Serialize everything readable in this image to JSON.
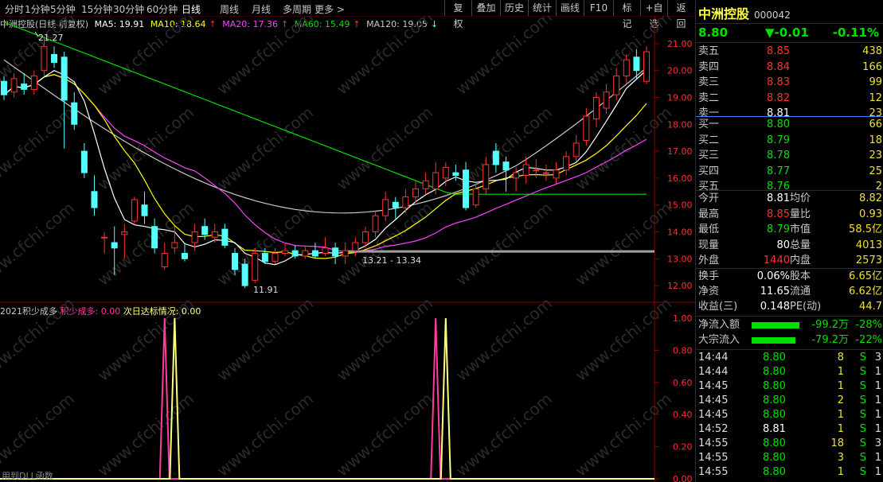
{
  "toolbar": {
    "periods": [
      "分时",
      "1分钟",
      "5分钟",
      "15分钟",
      "30分钟",
      "60分钟",
      "日线",
      "周线",
      "月线",
      "多周期",
      "更多 >"
    ],
    "active_period": "日线",
    "right_buttons": [
      "复权",
      "叠加",
      "历史",
      "统计",
      "画线",
      "F10",
      "标记",
      "+自选",
      "返回"
    ]
  },
  "ma_bar": {
    "title": "中洲控股(日线 前复权)",
    "ma5": "MA5: 19.91",
    "ma10": "MA10: 18.64",
    "ma20": "MA20: 17.36",
    "ma60": "MA60: 15.49",
    "ma120": "MA120: 19.05"
  },
  "colors": {
    "up": "#ff3232",
    "down": "#54ffff",
    "ma5": "#ffffff",
    "ma10": "#ffff00",
    "ma20": "#ff40ff",
    "ma60": "#00e000",
    "ma120": "#c8c8c8",
    "grid": "#8b0000"
  },
  "price_axis": [
    "21.00",
    "20.00",
    "19.00",
    "18.00",
    "17.00",
    "16.00",
    "15.00",
    "14.00",
    "13.00",
    "12.00"
  ],
  "annotations": {
    "high": "21.27",
    "low": "11.91",
    "range": "13.21 - 13.34"
  },
  "indicator": {
    "name": "2021积少成多",
    "series1_label": "积少成多: 0.00",
    "series2_label": "次日达标情况: 0.00",
    "axis": [
      "1.00",
      "0.80",
      "0.60",
      "0.40",
      "0.20",
      "0.00"
    ]
  },
  "footer_note": "用到DLL函数",
  "watermark": "www.cfchi.com",
  "quote": {
    "name": "中洲控股",
    "code": "000042",
    "price": "8.80",
    "change": "▼-0.01",
    "change_pct": "-0.11%",
    "asks": [
      {
        "label": "卖五",
        "price": "8.85",
        "vol": "438"
      },
      {
        "label": "卖四",
        "price": "8.84",
        "vol": "166"
      },
      {
        "label": "卖三",
        "price": "8.83",
        "vol": "99"
      },
      {
        "label": "卖二",
        "price": "8.82",
        "vol": "12"
      },
      {
        "label": "卖一",
        "price": "8.81",
        "vol": "23"
      }
    ],
    "bids": [
      {
        "label": "买一",
        "price": "8.80",
        "vol": "66"
      },
      {
        "label": "买二",
        "price": "8.79",
        "vol": "18"
      },
      {
        "label": "买三",
        "price": "8.78",
        "vol": "23"
      },
      {
        "label": "买四",
        "price": "8.77",
        "vol": "25"
      },
      {
        "label": "买五",
        "price": "8.76",
        "vol": "2"
      }
    ],
    "stats": [
      {
        "k1": "今开",
        "v1": "8.81",
        "c1": "white",
        "k2": "均价",
        "v2": "8.82",
        "c2": "red"
      },
      {
        "k1": "最高",
        "v1": "8.85",
        "c1": "red",
        "k2": "量比",
        "v2": "0.93",
        "c2": "green"
      },
      {
        "k1": "最低",
        "v1": "8.79",
        "c1": "green",
        "k2": "市值",
        "v2": "58.5亿",
        "c2": "white"
      },
      {
        "k1": "现量",
        "v1": "80",
        "c1": "white",
        "k2": "总量",
        "v2": "4013",
        "c2": "white"
      },
      {
        "k1": "外盘",
        "v1": "1440",
        "c1": "red",
        "k2": "内盘",
        "v2": "2573",
        "c2": "green"
      }
    ],
    "fin": [
      {
        "k1": "换手",
        "v1": "0.06%",
        "k2": "股本",
        "v2": "6.65亿"
      },
      {
        "k1": "净资",
        "v1": "11.65",
        "k2": "流通",
        "v2": "6.62亿"
      },
      {
        "k1": "收益(三)",
        "v1": "0.148",
        "k2": "PE(动)",
        "v2": "44.7"
      }
    ],
    "flows": [
      {
        "label": "净流入额",
        "value": "-99.2万",
        "pct": "-28%",
        "fill": 0.6
      },
      {
        "label": "大宗流入",
        "value": "-79.2万",
        "pct": "-22%",
        "fill": 0.55
      }
    ],
    "ticks": [
      {
        "time": "14:44",
        "price": "8.80",
        "vol": "8",
        "side": "S",
        "n": "3"
      },
      {
        "time": "14:44",
        "price": "8.80",
        "vol": "1",
        "side": "S",
        "n": "1"
      },
      {
        "time": "14:45",
        "price": "8.80",
        "vol": "1",
        "side": "S",
        "n": "1"
      },
      {
        "time": "14:45",
        "price": "8.80",
        "vol": "2",
        "side": "S",
        "n": "1"
      },
      {
        "time": "14:45",
        "price": "8.80",
        "vol": "1",
        "side": "S",
        "n": "1"
      },
      {
        "time": "14:52",
        "price": "8.81",
        "vol": "1",
        "side": "S",
        "n": "1"
      },
      {
        "time": "14:55",
        "price": "8.80",
        "vol": "18",
        "side": "S",
        "n": "3"
      },
      {
        "time": "14:55",
        "price": "8.80",
        "vol": "3",
        "side": "S",
        "n": "1"
      },
      {
        "time": "14:55",
        "price": "8.80",
        "vol": "1",
        "side": "S",
        "n": "1"
      }
    ]
  },
  "chart_data": {
    "type": "candlestick",
    "ylim": [
      11.5,
      21.5
    ],
    "candles": [
      {
        "o": 19.6,
        "c": 19.1,
        "h": 19.8,
        "l": 18.9
      },
      {
        "o": 19.2,
        "c": 19.7,
        "h": 19.9,
        "l": 19.0
      },
      {
        "o": 19.5,
        "c": 19.3,
        "h": 19.9,
        "l": 19.1
      },
      {
        "o": 19.3,
        "c": 19.8,
        "h": 20.0,
        "l": 19.1
      },
      {
        "o": 20.0,
        "c": 20.9,
        "h": 21.27,
        "l": 19.8
      },
      {
        "o": 20.6,
        "c": 20.3,
        "h": 20.9,
        "l": 20.1
      },
      {
        "o": 20.5,
        "c": 18.9,
        "h": 20.7,
        "l": 17.1
      },
      {
        "o": 18.8,
        "c": 18.0,
        "h": 19.2,
        "l": 17.8
      },
      {
        "o": 17.0,
        "c": 16.2,
        "h": 17.3,
        "l": 16.0
      },
      {
        "o": 15.5,
        "c": 14.9,
        "h": 16.1,
        "l": 14.6
      },
      {
        "o": 13.8,
        "c": 13.8,
        "h": 14.0,
        "l": 13.2
      },
      {
        "o": 13.6,
        "c": 13.4,
        "h": 14.2,
        "l": 12.4
      },
      {
        "o": 13.9,
        "c": 14.0,
        "h": 14.3,
        "l": 13.0
      },
      {
        "o": 14.4,
        "c": 15.2,
        "h": 15.3,
        "l": 14.3
      },
      {
        "o": 15.0,
        "c": 14.6,
        "h": 15.5,
        "l": 14.3
      },
      {
        "o": 14.2,
        "c": 13.4,
        "h": 14.5,
        "l": 13.2
      },
      {
        "o": 12.7,
        "c": 13.2,
        "h": 13.6,
        "l": 12.6
      },
      {
        "o": 13.4,
        "c": 13.6,
        "h": 14.2,
        "l": 13.2
      },
      {
        "o": 13.2,
        "c": 13.0,
        "h": 13.6,
        "l": 12.9
      },
      {
        "o": 13.6,
        "c": 14.0,
        "h": 14.3,
        "l": 13.3
      },
      {
        "o": 14.2,
        "c": 13.9,
        "h": 14.5,
        "l": 13.7
      },
      {
        "o": 13.8,
        "c": 14.0,
        "h": 14.3,
        "l": 13.6
      },
      {
        "o": 14.1,
        "c": 13.5,
        "h": 14.3,
        "l": 13.4
      },
      {
        "o": 13.2,
        "c": 12.6,
        "h": 13.4,
        "l": 12.4
      },
      {
        "o": 12.8,
        "c": 12.0,
        "h": 13.0,
        "l": 11.91
      },
      {
        "o": 12.2,
        "c": 13.2,
        "h": 13.4,
        "l": 12.1
      },
      {
        "o": 13.2,
        "c": 12.9,
        "h": 13.4,
        "l": 12.8
      },
      {
        "o": 12.9,
        "c": 13.2,
        "h": 13.4,
        "l": 12.8
      },
      {
        "o": 13.2,
        "c": 13.3,
        "h": 13.6,
        "l": 13.1
      },
      {
        "o": 13.3,
        "c": 13.1,
        "h": 13.5,
        "l": 13.0
      },
      {
        "o": 13.1,
        "c": 13.3,
        "h": 13.5,
        "l": 13.0
      },
      {
        "o": 13.3,
        "c": 13.1,
        "h": 13.6,
        "l": 13.0
      },
      {
        "o": 13.2,
        "c": 13.4,
        "h": 13.8,
        "l": 13.1
      },
      {
        "o": 13.4,
        "c": 13.1,
        "h": 13.6,
        "l": 12.8
      },
      {
        "o": 13.1,
        "c": 13.3,
        "h": 13.6,
        "l": 12.8
      },
      {
        "o": 13.3,
        "c": 13.6,
        "h": 13.8,
        "l": 13.1
      },
      {
        "o": 13.6,
        "c": 14.0,
        "h": 14.2,
        "l": 13.4
      },
      {
        "o": 14.0,
        "c": 14.6,
        "h": 14.8,
        "l": 13.8
      },
      {
        "o": 14.6,
        "c": 15.2,
        "h": 15.5,
        "l": 14.4
      },
      {
        "o": 15.1,
        "c": 14.9,
        "h": 15.3,
        "l": 14.5
      },
      {
        "o": 14.9,
        "c": 15.3,
        "h": 15.6,
        "l": 14.7
      },
      {
        "o": 15.3,
        "c": 15.6,
        "h": 15.9,
        "l": 15.1
      },
      {
        "o": 15.6,
        "c": 15.9,
        "h": 16.2,
        "l": 15.4
      },
      {
        "o": 15.6,
        "c": 16.2,
        "h": 16.6,
        "l": 15.4
      },
      {
        "o": 16.0,
        "c": 16.4,
        "h": 16.6,
        "l": 15.7
      },
      {
        "o": 16.2,
        "c": 16.1,
        "h": 16.5,
        "l": 15.9
      },
      {
        "o": 16.3,
        "c": 14.9,
        "h": 16.6,
        "l": 14.8
      },
      {
        "o": 15.0,
        "c": 15.6,
        "h": 15.8,
        "l": 14.9
      },
      {
        "o": 15.6,
        "c": 16.5,
        "h": 16.8,
        "l": 15.4
      },
      {
        "o": 17.0,
        "c": 16.5,
        "h": 17.3,
        "l": 16.2
      },
      {
        "o": 16.6,
        "c": 16.3,
        "h": 16.8,
        "l": 15.5
      },
      {
        "o": 16.0,
        "c": 16.2,
        "h": 16.4,
        "l": 15.5
      },
      {
        "o": 16.1,
        "c": 16.5,
        "h": 16.8,
        "l": 15.8
      },
      {
        "o": 16.3,
        "c": 16.3,
        "h": 16.7,
        "l": 16.0
      },
      {
        "o": 16.2,
        "c": 16.2,
        "h": 16.5,
        "l": 15.9
      },
      {
        "o": 16.0,
        "c": 16.3,
        "h": 16.6,
        "l": 15.8
      },
      {
        "o": 16.3,
        "c": 16.8,
        "h": 17.0,
        "l": 16.1
      },
      {
        "o": 16.8,
        "c": 17.3,
        "h": 17.6,
        "l": 16.6
      },
      {
        "o": 17.4,
        "c": 18.3,
        "h": 18.6,
        "l": 17.2
      },
      {
        "o": 18.2,
        "c": 19.0,
        "h": 19.2,
        "l": 17.9
      },
      {
        "o": 18.6,
        "c": 19.2,
        "h": 19.5,
        "l": 18.4
      },
      {
        "o": 19.1,
        "c": 19.8,
        "h": 20.1,
        "l": 18.9
      },
      {
        "o": 19.8,
        "c": 20.4,
        "h": 20.6,
        "l": 19.5
      },
      {
        "o": 20.5,
        "c": 20.0,
        "h": 20.8,
        "l": 19.7
      },
      {
        "o": 19.6,
        "c": 20.7,
        "h": 20.9,
        "l": 19.5
      }
    ],
    "horizontal_line": 13.27,
    "indicator_peaks": [
      {
        "index": 16,
        "series": "积少成多",
        "value": 1.0
      },
      {
        "index": 17,
        "series": "次日达标情况",
        "value": 1.0
      },
      {
        "index": 43,
        "series": "积少成多",
        "value": 1.0
      },
      {
        "index": 44,
        "series": "次日达标情况",
        "value": 1.0
      }
    ]
  }
}
